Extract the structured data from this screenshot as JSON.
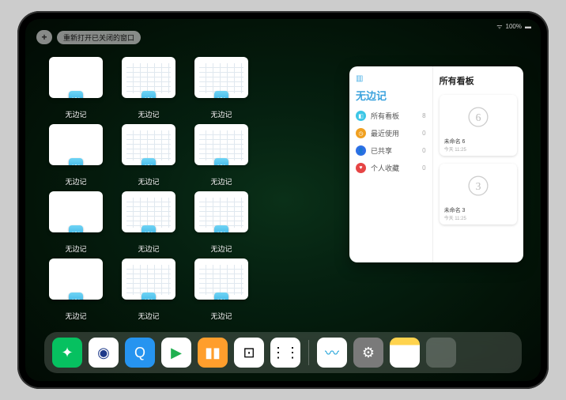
{
  "status": {
    "battery": "100%"
  },
  "top": {
    "plus": "+",
    "reopen_label": "重新打开已关闭的窗口"
  },
  "app_switcher": {
    "thumbnails": [
      {
        "label": "无边记",
        "style": "blank"
      },
      {
        "label": "无边记",
        "style": "grid"
      },
      {
        "label": "无边记",
        "style": "grid-stack"
      },
      {
        "label": "无边记",
        "style": "blank"
      },
      {
        "label": "无边记",
        "style": "grid"
      },
      {
        "label": "无边记",
        "style": "grid"
      },
      {
        "label": "无边记",
        "style": "blank"
      },
      {
        "label": "无边记",
        "style": "grid"
      },
      {
        "label": "无边记",
        "style": "grid-stack"
      },
      {
        "label": "无边记",
        "style": "blank"
      },
      {
        "label": "无边记",
        "style": "grid"
      },
      {
        "label": "无边记",
        "style": "grid-stack"
      }
    ]
  },
  "panel": {
    "left_title": "无边记",
    "right_title": "所有看板",
    "sidebar": [
      {
        "icon_color": "#3cc6e6",
        "glyph": "◧",
        "label": "所有看板",
        "count": "8"
      },
      {
        "icon_color": "#f0a020",
        "glyph": "◷",
        "label": "最近使用",
        "count": "0"
      },
      {
        "icon_color": "#2e6fe6",
        "glyph": "👤",
        "label": "已共享",
        "count": "0"
      },
      {
        "icon_color": "#e64545",
        "glyph": "♥",
        "label": "个人收藏",
        "count": "0"
      }
    ],
    "cards": [
      {
        "digit": "6",
        "title": "未命名 6",
        "time": "今天 11:25"
      },
      {
        "digit": "3",
        "title": "未命名 3",
        "time": "今天 11:25"
      }
    ]
  },
  "dock": {
    "apps": [
      {
        "name": "wechat",
        "bg": "#06c160",
        "glyph": "✦"
      },
      {
        "name": "tencent-video",
        "bg": "#ffffff",
        "glyph": "◉",
        "fg": "#1e3a8a"
      },
      {
        "name": "qq-browser",
        "bg": "#2694f0",
        "glyph": "Q"
      },
      {
        "name": "play",
        "bg": "#ffffff",
        "glyph": "▶",
        "fg": "#20b050"
      },
      {
        "name": "books",
        "bg": "#ff9e2c",
        "glyph": "▮▮"
      },
      {
        "name": "dice",
        "bg": "#ffffff",
        "glyph": "⊡",
        "fg": "#000"
      },
      {
        "name": "nodes",
        "bg": "#ffffff",
        "glyph": "⋮⋮",
        "fg": "#000"
      }
    ],
    "recent": [
      {
        "name": "freeform",
        "bg": "#ffffff",
        "glyph": "〰",
        "fg": "#1aa0d8"
      },
      {
        "name": "settings",
        "bg": "#7a7a7a",
        "glyph": "⚙"
      },
      {
        "name": "notes",
        "bg": "linear-gradient(#ffd34d 25%, #fff 25%)",
        "glyph": ""
      }
    ]
  }
}
